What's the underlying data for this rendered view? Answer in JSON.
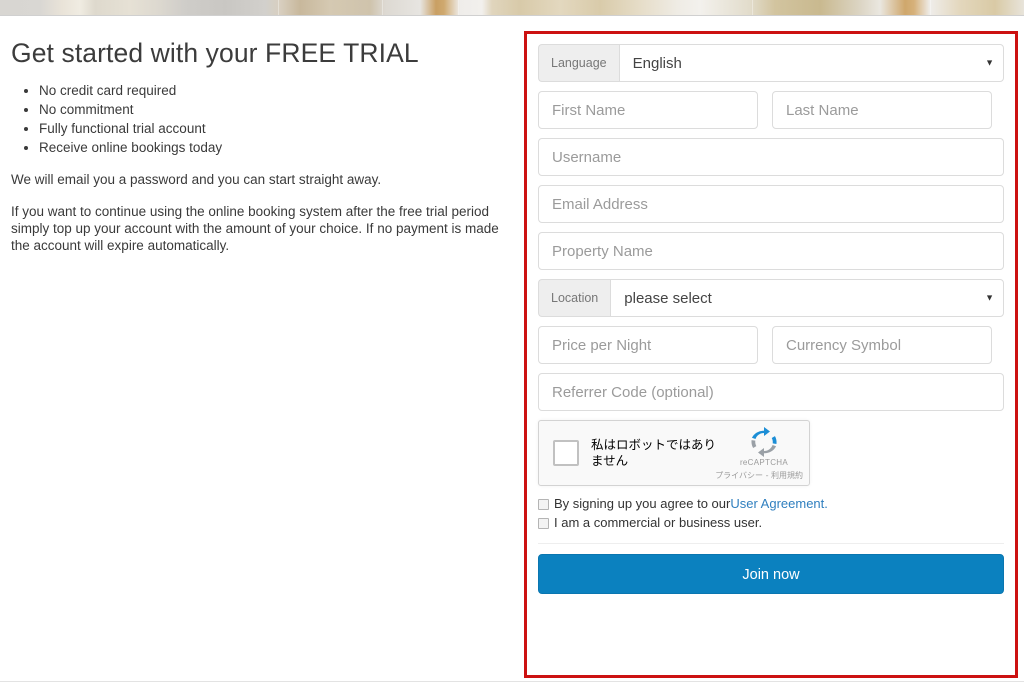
{
  "hero": {
    "image_alt": "room-photo-strip"
  },
  "left": {
    "title": "Get started with your FREE TRIAL",
    "benefits": [
      "No credit card required",
      "No commitment",
      "Fully functional trial account",
      "Receive online bookings today"
    ],
    "para_1": "We will email you a password and you can start straight away.",
    "para_2": "If you want to continue using the online booking system after the free trial period simply top up your account with the amount of your choice. If no payment is made the account will expire automatically."
  },
  "form": {
    "language": {
      "addon_label": "Language",
      "selected": "English",
      "arrow": "▼"
    },
    "first_name_placeholder": "First Name",
    "last_name_placeholder": "Last Name",
    "username_placeholder": "Username",
    "email_placeholder": "Email Address",
    "property_name_placeholder": "Property Name",
    "location": {
      "addon_label": "Location",
      "selected": "please select",
      "arrow": "▼"
    },
    "price_placeholder": "Price per Night",
    "currency_placeholder": "Currency Symbol",
    "referrer_placeholder": "Referrer Code (optional)",
    "recaptcha": {
      "label": "私はロボットではありません",
      "brand": "reCAPTCHA",
      "legal": "プライバシー - 利用規約"
    },
    "agreement": {
      "text_before_link": "By signing up you agree to our ",
      "link_text": "User Agreement.",
      "commercial_text": "I am a commercial or business user."
    },
    "submit_label": "Join now"
  },
  "colors": {
    "highlight_border": "#cc1111",
    "submit_button": "#0b81bf",
    "link": "#2f7fbf",
    "addon_background": "#eeeeee",
    "placeholder_text": "#9b9b9b"
  }
}
